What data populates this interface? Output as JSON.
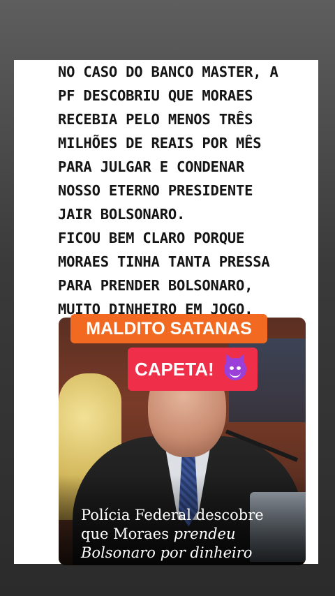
{
  "headline": {
    "lines": [
      "NO CASO DO BANCO MASTER, A",
      "PF DESCOBRIU QUE MORAES",
      "RECEBIA PELO MENOS TRÊS",
      "MILHÕES DE REAIS POR MÊS",
      "PARA JULGAR E CONDENAR",
      "NOSSO ETERNO PRESIDENTE",
      "JAIR BOLSONARO.",
      "FICOU BEM CLARO PORQUE",
      "MORAES TINHA TANTA PRESSA",
      "PARA PRENDER BOLSONARO,",
      "MUITO DINHEIRO EM JOGO."
    ]
  },
  "stickers": {
    "orange": "MALDITO SATANAS",
    "red": "CAPETA!",
    "red_emoji": "smiling-devil-icon"
  },
  "photo": {
    "caption_line1": "Polícia Federal descobre",
    "caption_line2_a": "que Moraes ",
    "caption_line2_b": "prendeu",
    "caption_line3": "Bolsonaro por dinheiro"
  },
  "colors": {
    "orange_sticker": "#f26a21",
    "red_sticker": "#ef2f49",
    "devil": "#9b3fd9"
  }
}
